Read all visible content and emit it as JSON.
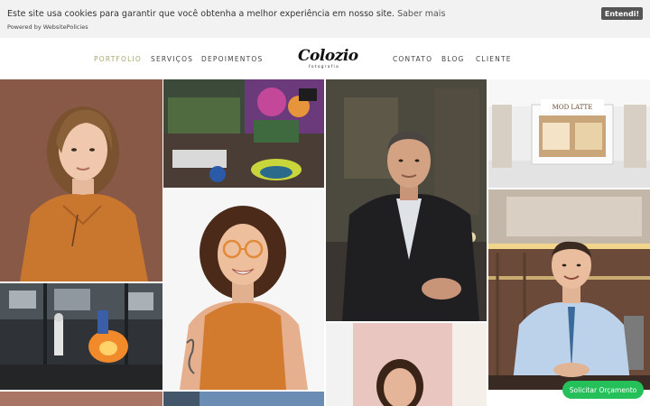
{
  "cookie": {
    "message": "Este site usa cookies para garantir que você obtenha a melhor experiência em nosso site.",
    "learn_more": "Saber mais",
    "powered_by": "Powered by WebsitePolicies",
    "accept_label": "Entendi!"
  },
  "nav": {
    "left": [
      "PORTFOLIO",
      "SERVIÇOS",
      "DEPOIMENTOS"
    ],
    "right": [
      "CONTATO",
      "BLOG",
      "CLIENTE"
    ],
    "active": "PORTFOLIO",
    "active_color": "#a5a86e"
  },
  "logo": {
    "name": "Colozio",
    "tagline": "fotografia"
  },
  "store_sign": "MOD LATTE",
  "quote_button": "Solicitar Orçamento",
  "colors": {
    "whatsapp_green": "#25c05a",
    "cookie_button": "#555555"
  }
}
